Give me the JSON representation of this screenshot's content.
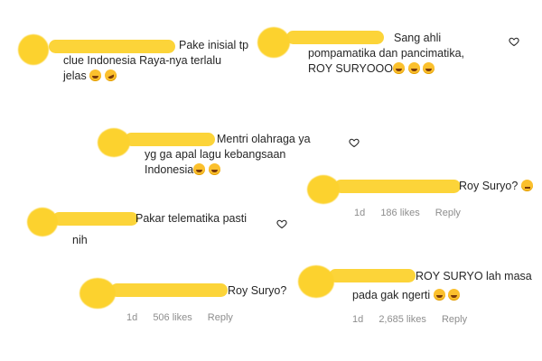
{
  "comments": [
    {
      "text_lines": [
        "Pake inisial tp",
        "clue Indonesia Raya-nya terlalu",
        "jelas"
      ],
      "emojis": [
        "grin",
        "rofl"
      ]
    },
    {
      "text_lines": [
        "Sang ahli",
        "pompamatika dan pancimatika,",
        "ROY SURYOOO"
      ],
      "emojis": [
        "grin",
        "grin",
        "grin"
      ]
    },
    {
      "text_lines": [
        "Mentri olahraga ya",
        "yg ga apal lagu kebangsaan",
        "Indonesia"
      ],
      "emojis": [
        "grin",
        "grin"
      ]
    },
    {
      "text_lines": [
        "Roy Suryo?"
      ],
      "emojis": [
        "think"
      ],
      "meta": {
        "time": "1d",
        "likes": "186 likes",
        "reply": "Reply"
      }
    },
    {
      "text_lines": [
        "Pakar telematika pasti",
        "nih"
      ],
      "emojis": []
    },
    {
      "text_lines": [
        "Roy Suryo?"
      ],
      "emojis": [],
      "meta": {
        "time": "1d",
        "likes": "506 likes",
        "reply": "Reply"
      }
    },
    {
      "text_lines": [
        "ROY SURYO lah masa",
        "pada gak ngerti"
      ],
      "emojis": [
        "grin",
        "grin"
      ],
      "meta": {
        "time": "1d",
        "likes": "2,685 likes",
        "reply": "Reply"
      }
    }
  ],
  "colors": {
    "blur": "#fcd22e",
    "text": "#262626",
    "meta": "#8e8e8e"
  },
  "icons": {
    "like": "heart-outline-icon"
  }
}
